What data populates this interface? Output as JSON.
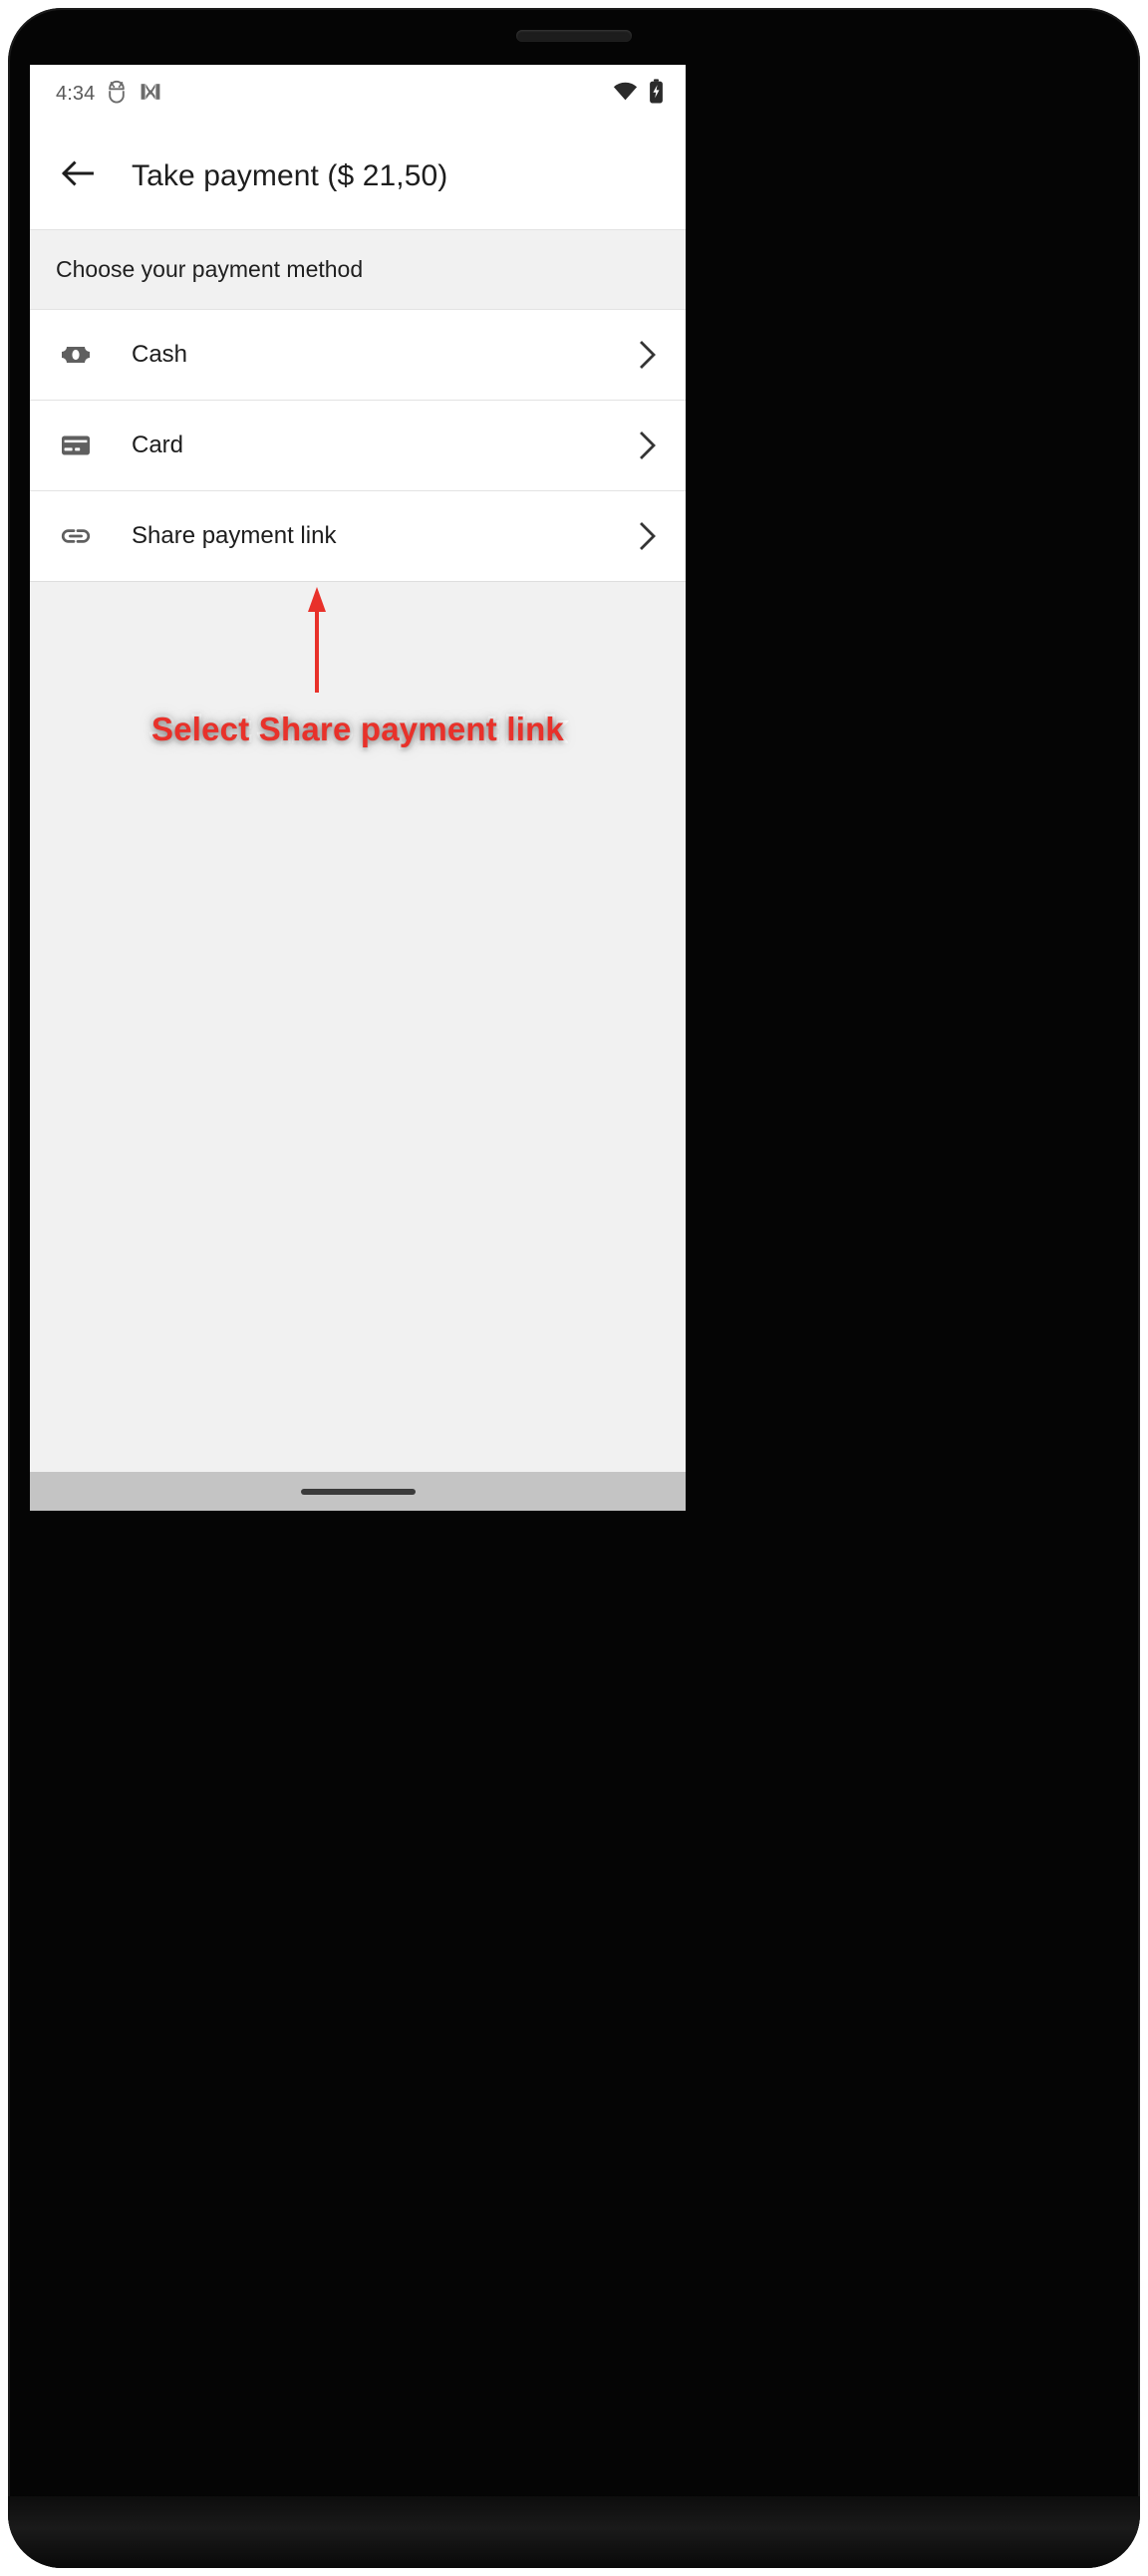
{
  "status_bar": {
    "time": "4:34",
    "left_icons": [
      "android-robot-icon",
      "m-logo-icon"
    ],
    "right_icons": [
      "wifi-icon",
      "battery-charging-icon"
    ]
  },
  "app_bar": {
    "back_icon": "back-arrow-icon",
    "title": "Take payment ($ 21,50)",
    "amount": "$ 21,50"
  },
  "section": {
    "header": "Choose your payment method"
  },
  "payment_methods": [
    {
      "label": "Cash",
      "icon": "banknote-icon",
      "chevron": "chevron-right-icon"
    },
    {
      "label": "Card",
      "icon": "credit-card-icon",
      "chevron": "chevron-right-icon"
    },
    {
      "label": "Share payment link",
      "icon": "link-chain-icon",
      "chevron": "chevron-right-icon"
    }
  ],
  "annotation": {
    "text": "Select Share payment link",
    "color": "#e8312a",
    "arrow": "up-arrow-annotation",
    "target": "Share payment link"
  },
  "nav_bar": {
    "handle": "gesture-home-handle"
  },
  "colors": {
    "accent_red": "#e8312a",
    "icon_gray": "#5f5f5f",
    "text_primary": "#1d1d1d",
    "surface": "#ffffff",
    "background": "#f1f1f1",
    "divider": "#e3e3e3",
    "nav_bar": "#c4c4c4"
  }
}
